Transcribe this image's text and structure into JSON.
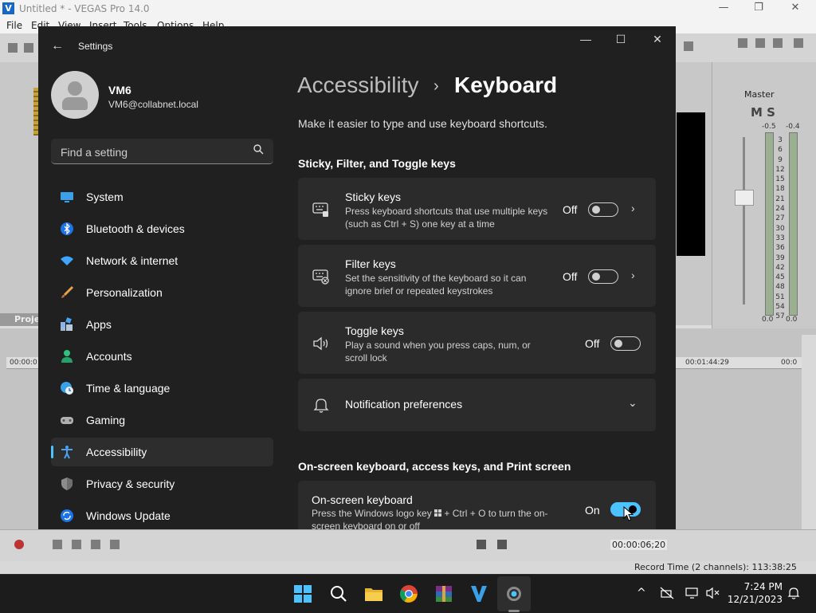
{
  "vegas": {
    "title": "Untitled * - VEGAS Pro 14.0",
    "menu": [
      "File",
      "Edit",
      "View",
      "Insert",
      "Tools",
      "Options",
      "Help"
    ],
    "project_tab": "Proje",
    "master_label": "Master",
    "master_db_left": "-0.5",
    "master_db_right": "-0.4",
    "meter_scale": [
      "3",
      "6",
      "9",
      "12",
      "15",
      "18",
      "21",
      "24",
      "27",
      "30",
      "33",
      "36",
      "39",
      "42",
      "45",
      "48",
      "51",
      "54",
      "57"
    ],
    "master_zero_left": "0.0",
    "master_zero_right": "0.0",
    "ruler": [
      "00:00:0",
      "00:01:44:29",
      "00:0"
    ],
    "timecode": "00:00:06;20",
    "record_time": "Record Time (2 channels): 113:38:25"
  },
  "settings": {
    "app_title": "Settings",
    "user": {
      "name": "VM6",
      "email": "VM6@collabnet.local"
    },
    "search_placeholder": "Find a setting",
    "nav": [
      {
        "label": "System",
        "icon": "system-icon"
      },
      {
        "label": "Bluetooth & devices",
        "icon": "bluetooth-icon"
      },
      {
        "label": "Network & internet",
        "icon": "wifi-icon"
      },
      {
        "label": "Personalization",
        "icon": "brush-icon"
      },
      {
        "label": "Apps",
        "icon": "apps-icon"
      },
      {
        "label": "Accounts",
        "icon": "accounts-icon"
      },
      {
        "label": "Time & language",
        "icon": "globe-clock-icon"
      },
      {
        "label": "Gaming",
        "icon": "gamepad-icon"
      },
      {
        "label": "Accessibility",
        "icon": "accessibility-icon",
        "selected": true
      },
      {
        "label": "Privacy & security",
        "icon": "shield-icon"
      },
      {
        "label": "Windows Update",
        "icon": "update-icon"
      }
    ],
    "breadcrumb": {
      "parent": "Accessibility",
      "separator": "›",
      "current": "Keyboard"
    },
    "description": "Make it easier to type and use keyboard shortcuts.",
    "section1": "Sticky, Filter, and Toggle keys",
    "cards": [
      {
        "title": "Sticky keys",
        "desc": "Press keyboard shortcuts that use multiple keys (such as Ctrl + S) one key at a time",
        "state": "Off",
        "on": false
      },
      {
        "title": "Filter keys",
        "desc": "Set the sensitivity of the keyboard so it can ignore brief or repeated keystrokes",
        "state": "Off",
        "on": false
      },
      {
        "title": "Toggle keys",
        "desc": "Play a sound when you press caps, num, or scroll lock",
        "state": "Off",
        "on": false
      }
    ],
    "notification_label": "Notification preferences",
    "section2": "On-screen keyboard, access keys, and Print screen",
    "osk": {
      "title": "On-screen keyboard",
      "desc_before": "Press the Windows logo key",
      "desc_after": "+ Ctrl + O to turn the on-screen keyboard on or off",
      "state": "On",
      "on": true
    },
    "accent": "#4cc2ff"
  },
  "taskbar": {
    "time": "7:24 PM",
    "date": "12/21/2023",
    "apps": [
      "start-icon",
      "search-icon",
      "file-explorer-icon",
      "chrome-icon",
      "winrar-icon",
      "vegas-icon",
      "settings-icon"
    ]
  }
}
